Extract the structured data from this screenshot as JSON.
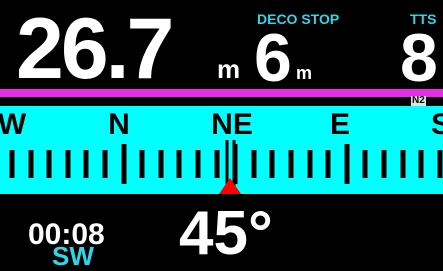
{
  "depth": {
    "value": "26.7",
    "unit": "m"
  },
  "deco_stop": {
    "label": "DECO STOP",
    "depth": "6",
    "unit": "m"
  },
  "tts": {
    "label": "TTS",
    "value": "8"
  },
  "gas": {
    "label": "N2",
    "color": "#e62ee6"
  },
  "compass": {
    "cardinals": [
      "W",
      "N",
      "NE",
      "E",
      "S"
    ],
    "background": "#00ffff",
    "pointer_color": "#ff0000"
  },
  "dive_time": "00:08",
  "bearing_label": "SW",
  "heading": "45°"
}
